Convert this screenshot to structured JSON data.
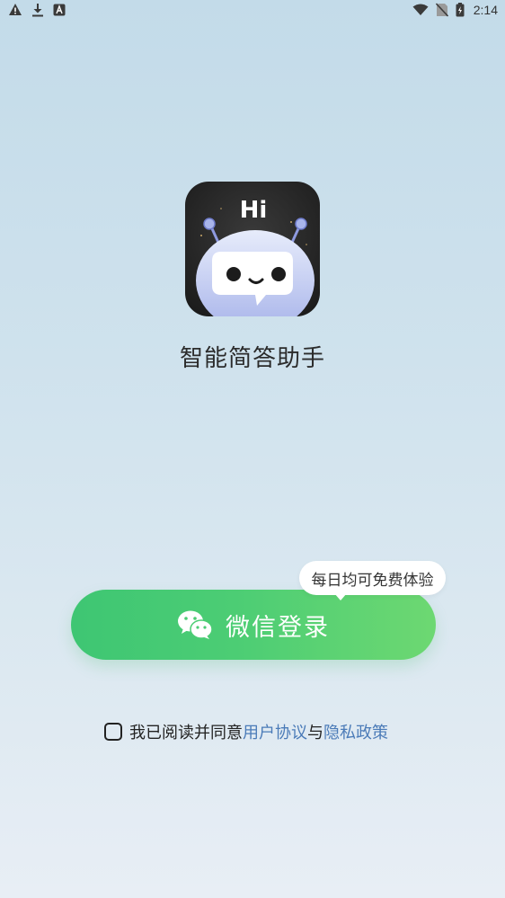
{
  "status_bar": {
    "time": "2:14",
    "left_icons": [
      "warning-icon",
      "download-icon",
      "app-a-icon"
    ],
    "right_icons": [
      "wifi-icon",
      "no-sim-icon",
      "battery-icon"
    ]
  },
  "app": {
    "logo_text": "Hi",
    "name": "智能简答助手"
  },
  "login": {
    "button_label": "微信登录",
    "promo_text": "每日均可免费体验",
    "button_icon": "wechat-icon",
    "colors": {
      "start": "#3ec673",
      "end": "#6dd872"
    }
  },
  "agreement": {
    "prefix": "我已阅读并同意",
    "user_agreement": "用户协议",
    "conjunction": "与",
    "privacy_policy": "隐私政策",
    "checked": false,
    "link_color": "#4b7bb8"
  }
}
